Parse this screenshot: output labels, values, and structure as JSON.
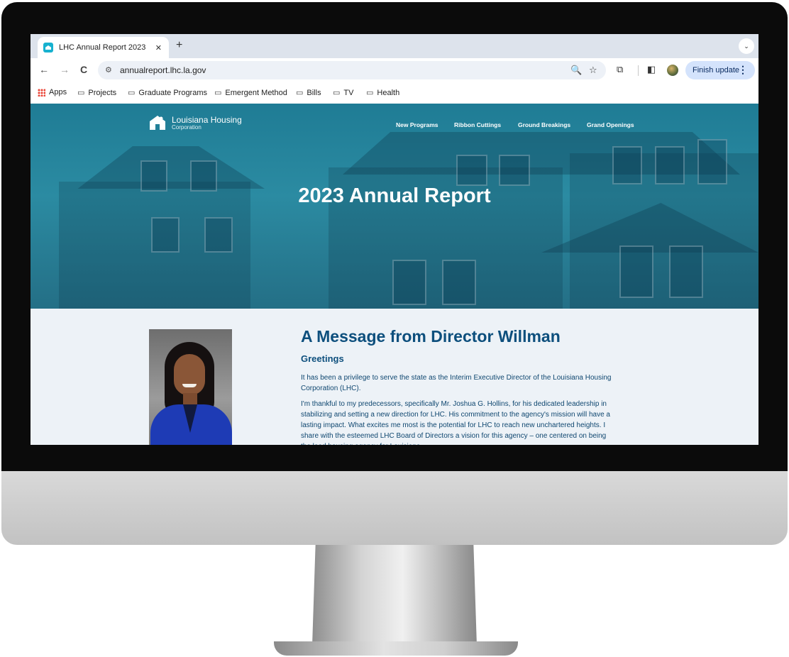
{
  "browser": {
    "tab_title": "LHC Annual Report 2023",
    "tab_close": "✕",
    "new_tab": "+",
    "tab_search": "⌄",
    "back": "←",
    "forward": "→",
    "reload": "C",
    "site_info": "⚙",
    "url": "annualreport.lhc.la.gov",
    "zoom": "🔍",
    "bookmark_star": "☆",
    "extensions": "⧉",
    "side_panel": "◧",
    "update_label": "Finish update",
    "menu_dots": "⋮",
    "bookmarks": [
      {
        "label": "Apps"
      },
      {
        "label": "Projects"
      },
      {
        "label": "Graduate Programs"
      },
      {
        "label": "Emergent Method"
      },
      {
        "label": "Bills"
      },
      {
        "label": "TV"
      },
      {
        "label": "Health"
      }
    ],
    "folder_glyph": "▭"
  },
  "site": {
    "logo_name": "Louisiana Housing",
    "logo_sub": "Corporation",
    "nav": [
      {
        "label": "New Programs"
      },
      {
        "label": "Ribbon Cuttings"
      },
      {
        "label": "Ground Breakings"
      },
      {
        "label": "Grand Openings"
      }
    ],
    "hero_title": "2023 Annual Report"
  },
  "message": {
    "title": "A Message from Director Willman",
    "greeting": "Greetings",
    "paragraphs": [
      "It has been a privilege to serve the state as the Interim Executive Director of the Louisiana Housing Corporation (LHC).",
      "I'm thankful to my predecessors, specifically Mr. Joshua G. Hollins, for his dedicated leadership in stabilizing and setting a new direction for LHC. His commitment to the agency's mission will have a lasting impact. What excites me most is the potential for LHC to reach new unchartered heights. I share with the esteemed LHC Board of Directors a vision for this agency – one centered on being the lead housing agency for Louisiana."
    ]
  },
  "colors": {
    "heading_blue": "#0d4f7d",
    "hero_teal": "#2b8ba2",
    "update_button_bg": "#d4e3fc"
  }
}
